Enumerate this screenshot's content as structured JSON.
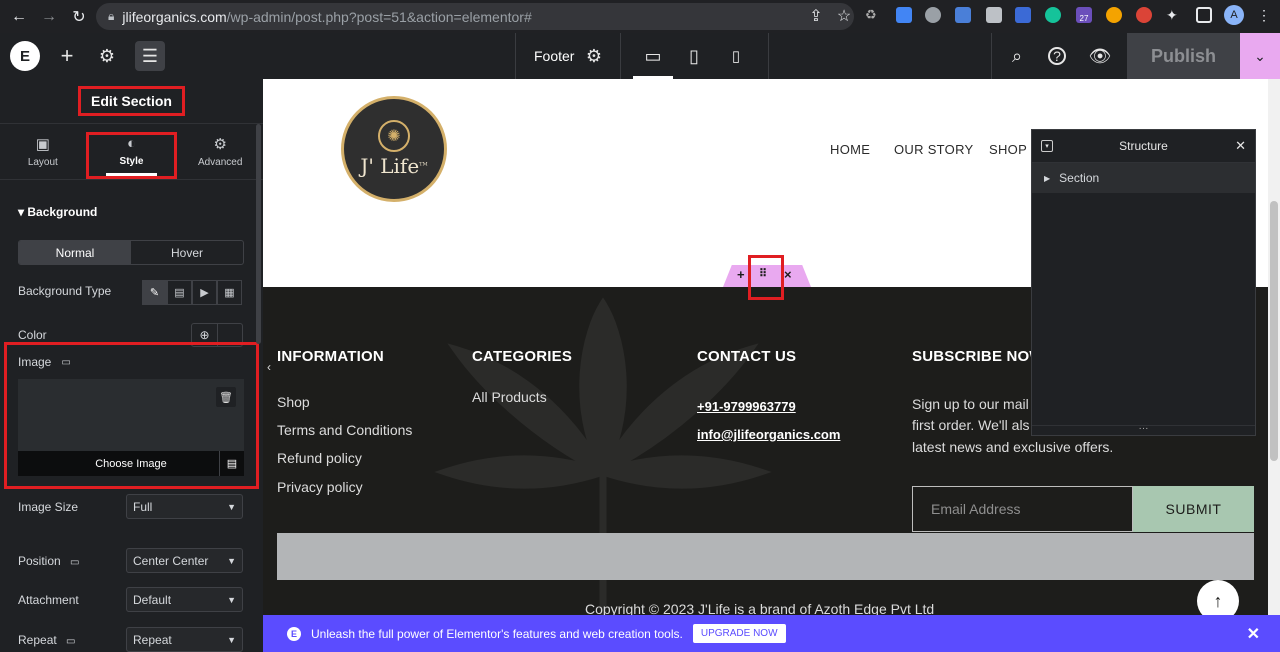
{
  "browser": {
    "url_host": "jlifeorganics.com",
    "url_path": "/wp-admin/post.php?post=51&action=elementor#",
    "profile_initial": "A",
    "ext_badge": "27"
  },
  "editor_bar": {
    "document_title": "Footer",
    "publish_label": "Publish"
  },
  "panel": {
    "title": "Edit Section",
    "tabs": [
      {
        "label": "Layout",
        "icon": "layout-icon"
      },
      {
        "label": "Style",
        "icon": "contrast-icon"
      },
      {
        "label": "Advanced",
        "icon": "gear-icon"
      }
    ],
    "background_heading": "Background",
    "state_normal": "Normal",
    "state_hover": "Hover",
    "bg_type_label": "Background Type",
    "color_label": "Color",
    "image_label": "Image",
    "choose_image": "Choose Image",
    "image_size_label": "Image Size",
    "image_size_value": "Full",
    "position_label": "Position",
    "position_value": "Center Center",
    "attachment_label": "Attachment",
    "attachment_value": "Default",
    "repeat_label": "Repeat",
    "repeat_value": "Repeat"
  },
  "site": {
    "logo_text": "J' Life",
    "logo_tm": "TM",
    "menu": [
      "HOME",
      "OUR STORY",
      "SHOP"
    ],
    "footer": {
      "col1_heading": "INFORMATION",
      "col1_links": [
        "Shop",
        "Terms and Conditions",
        "Refund policy",
        "Privacy policy"
      ],
      "col2_heading": "CATEGORIES",
      "col2_links": [
        "All Products"
      ],
      "col3_heading": "CONTACT US",
      "phone": "+91-9799963779",
      "email": "info@jlifeorganics.com",
      "col4_heading": "SUBSCRIBE NOW",
      "subscribe_text_1": "Sign up to our mail",
      "subscribe_text_2": "first order. We'll als",
      "subscribe_text_3": "latest news and exclusive offers.",
      "email_placeholder": "Email Address",
      "submit_label": "SUBMIT",
      "copyright": "Copyright © 2023 J'Life is a brand of Azoth Edge Pvt Ltd"
    }
  },
  "structure": {
    "title": "Structure",
    "item": "Section"
  },
  "promo": {
    "text": "Unleash the full power of Elementor's features and web creation tools.",
    "button": "UPGRADE NOW"
  },
  "colors": {
    "highlight_red": "#e01e22",
    "elementor_pink": "#e9a9f0",
    "promo_purple": "#5b4cff",
    "submit_green": "#a8c7b0",
    "footer_dark": "#1d1d1b"
  }
}
